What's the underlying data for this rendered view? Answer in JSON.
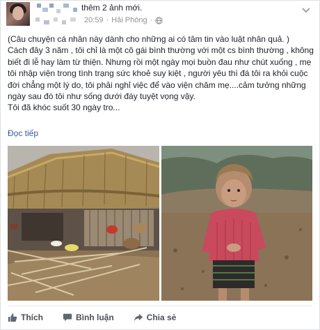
{
  "post": {
    "header_text": "thêm 2 ảnh mới.",
    "time": "20:59",
    "separator": "·",
    "location": "Hải Phòng",
    "paragraphs": [
      "(Câu chuyện cá nhân này dành cho những ai có tâm tin vào luật nhân quả. )",
      "Cách đây 3 năm , tôi chỉ là một cô gái bình thường với một cs bình thường , không biết đi lễ hay làm từ thiện. Nhưng rồi một ngày mọi buồn đau như chút xuống , mẹ tôi nhập viện trong tình trạng sức khoẻ suy kiệt , người yêu thì đá tôi ra khỏi cuộc đời chẳng một lý do, tôi phải nghỉ việc để vào viện chăm mẹ....cảm tưởng những ngày sau đó tôi như sống dưới đáy tuyệt vọng vậy.",
      "Tôi đã khóc suốt 30 ngày tro..."
    ],
    "read_more": "Đọc tiếp"
  },
  "actions": {
    "like": "Thích",
    "comment": "Bình luận",
    "share": "Chia sẻ"
  },
  "icons": {
    "like": "thumbs-up-icon",
    "comment": "comment-icon",
    "share": "share-icon",
    "privacy": "globe-icon",
    "options": "chevron-down-icon"
  },
  "colors": {
    "link": "#365899",
    "meta": "#90949c",
    "action_text": "#4b4f56"
  }
}
